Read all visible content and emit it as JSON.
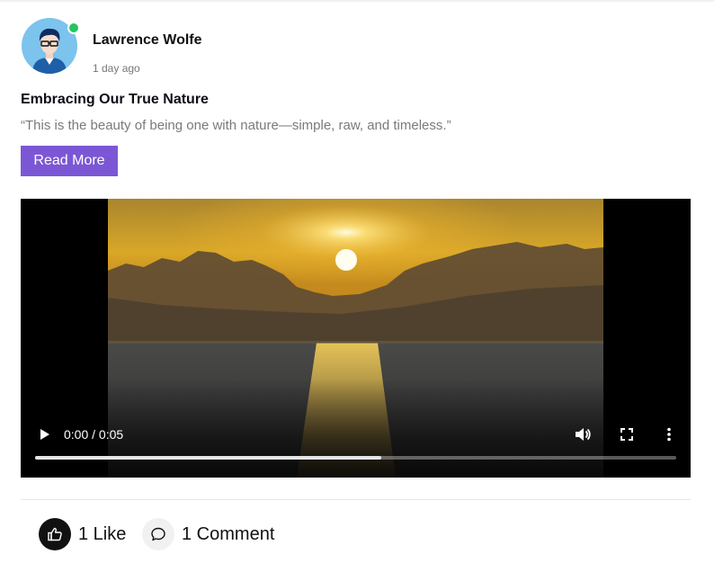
{
  "post": {
    "author": "Lawrence Wolfe",
    "time_ago": "1 day ago",
    "author_online": true,
    "title": "Embracing Our True Nature",
    "quote": "“This is the beauty of being one with nature—simple, raw, and timeless.”",
    "read_more_label": "Read More",
    "accent_color": "#7b57d6"
  },
  "video": {
    "time": "0:00 / 0:05",
    "buffered_fraction": 0.54,
    "icons": [
      "play-icon",
      "volume-icon",
      "fullscreen-icon",
      "more-vertical-icon"
    ]
  },
  "footer": {
    "like_label": "1 Like",
    "comment_label": "1 Comment",
    "icons": [
      "thumbs-up-icon",
      "comment-bubble-icon"
    ]
  }
}
